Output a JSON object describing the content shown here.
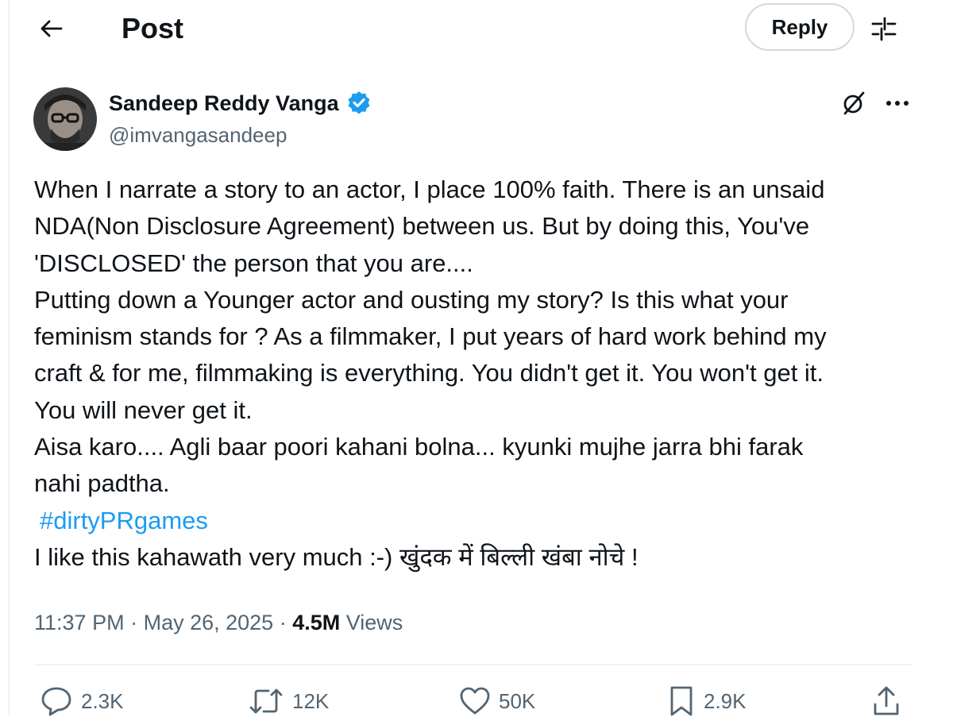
{
  "header": {
    "title": "Post",
    "reply_label": "Reply"
  },
  "author": {
    "name": "Sandeep Reddy Vanga",
    "handle": "@imvangasandeep",
    "verified": true
  },
  "post": {
    "lines": [
      "When I narrate a story to an actor, I place 100% faith. There is an unsaid",
      "NDA(Non Disclosure Agreement) between us. But by doing this, You've",
      "'DISCLOSED' the person that you are....",
      "Putting down a Younger actor and ousting my story?  Is this what your",
      "feminism stands for ? As a filmmaker, I put years of hard work behind my",
      "craft & for me, filmmaking is everything. You didn't get it. You won't get it.",
      "You will never get it.",
      "Aisa karo.... Agli baar poori kahani bolna... kyunki mujhe jarra bhi farak",
      "nahi padtha."
    ],
    "hashtag": "#dirtyPRgames",
    "closing_line": "I like this kahawath very much :-) खुंदक में बिल्ली खंबा नोचे !"
  },
  "meta": {
    "time": "11:37 PM",
    "date": "May 26, 2025",
    "views_count": "4.5M",
    "views_label": "Views"
  },
  "actions": {
    "replies": "2.3K",
    "reposts": "12K",
    "likes": "50K",
    "bookmarks": "2.9K"
  },
  "colors": {
    "text": "#0f1419",
    "secondary": "#536471",
    "accent": "#1d9bf0",
    "divider": "#eff3f4"
  },
  "icons": [
    "back-arrow-icon",
    "filter-icon",
    "verified-icon",
    "grok-icon",
    "more-icon",
    "reply-icon",
    "repost-icon",
    "like-icon",
    "bookmark-icon",
    "share-icon"
  ]
}
